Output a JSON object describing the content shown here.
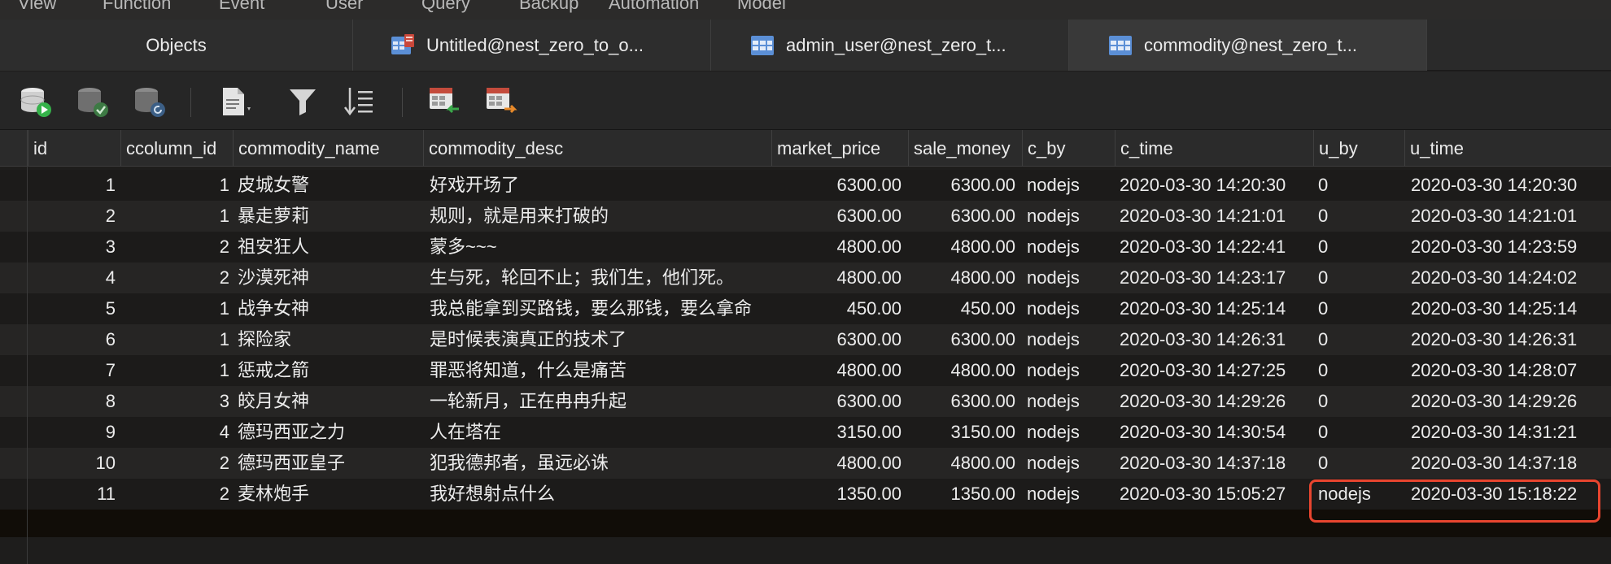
{
  "menu": [
    "View",
    "Function",
    "Event",
    "User",
    "Query",
    "Backup",
    "Automation",
    "Model"
  ],
  "tabs": [
    {
      "label": "Objects",
      "icon": "none"
    },
    {
      "label": "Untitled@nest_zero_to_o...",
      "icon": "query-table-icon"
    },
    {
      "label": "admin_user@nest_zero_t...",
      "icon": "table-icon"
    },
    {
      "label": "commodity@nest_zero_t...",
      "icon": "table-icon"
    }
  ],
  "toolbar": [
    "begin-transaction-icon",
    "commit-icon",
    "rollback-icon",
    "text-view-icon",
    "filter-icon",
    "sort-icon",
    "import-icon",
    "export-icon"
  ],
  "columns": [
    "id",
    "ccolumn_id",
    "commodity_name",
    "commodity_desc",
    "market_price",
    "sale_money",
    "c_by",
    "c_time",
    "u_by",
    "u_time"
  ],
  "rows": [
    [
      "1",
      "1",
      "皮城女警",
      "好戏开场了",
      "6300.00",
      "6300.00",
      "nodejs",
      "2020-03-30 14:20:30",
      "0",
      "2020-03-30 14:20:30"
    ],
    [
      "2",
      "1",
      "暴走萝莉",
      "规则，就是用来打破的",
      "6300.00",
      "6300.00",
      "nodejs",
      "2020-03-30 14:21:01",
      "0",
      "2020-03-30 14:21:01"
    ],
    [
      "3",
      "2",
      "祖安狂人",
      "蒙多~~~",
      "4800.00",
      "4800.00",
      "nodejs",
      "2020-03-30 14:22:41",
      "0",
      "2020-03-30 14:23:59"
    ],
    [
      "4",
      "2",
      "沙漠死神",
      "生与死，轮回不止；我们生，他们死。",
      "4800.00",
      "4800.00",
      "nodejs",
      "2020-03-30 14:23:17",
      "0",
      "2020-03-30 14:24:02"
    ],
    [
      "5",
      "1",
      "战争女神",
      "我总能拿到买路钱，要么那钱，要么拿命",
      "450.00",
      "450.00",
      "nodejs",
      "2020-03-30 14:25:14",
      "0",
      "2020-03-30 14:25:14"
    ],
    [
      "6",
      "1",
      "探险家",
      "是时候表演真正的技术了",
      "6300.00",
      "6300.00",
      "nodejs",
      "2020-03-30 14:26:31",
      "0",
      "2020-03-30 14:26:31"
    ],
    [
      "7",
      "1",
      "惩戒之箭",
      "罪恶将知道，什么是痛苦",
      "4800.00",
      "4800.00",
      "nodejs",
      "2020-03-30 14:27:25",
      "0",
      "2020-03-30 14:28:07"
    ],
    [
      "8",
      "3",
      "皎月女神",
      "一轮新月，正在冉冉升起",
      "6300.00",
      "6300.00",
      "nodejs",
      "2020-03-30 14:29:26",
      "0",
      "2020-03-30 14:29:26"
    ],
    [
      "9",
      "4",
      "德玛西亚之力",
      "人在塔在",
      "3150.00",
      "3150.00",
      "nodejs",
      "2020-03-30 14:30:54",
      "0",
      "2020-03-30 14:31:21"
    ],
    [
      "10",
      "2",
      "德玛西亚皇子",
      "犯我德邦者，虽远必诛",
      "4800.00",
      "4800.00",
      "nodejs",
      "2020-03-30 14:37:18",
      "0",
      "2020-03-30 14:37:18"
    ],
    [
      "11",
      "2",
      "麦林炮手",
      "我好想射点什么",
      "1350.00",
      "1350.00",
      "nodejs",
      "2020-03-30 15:05:27",
      "nodejs",
      "2020-03-30 15:18:22"
    ]
  ],
  "colors": {
    "accent_highlight": "#e8452f",
    "row_even": "#262524",
    "row_odd": "#1c1b1a"
  }
}
